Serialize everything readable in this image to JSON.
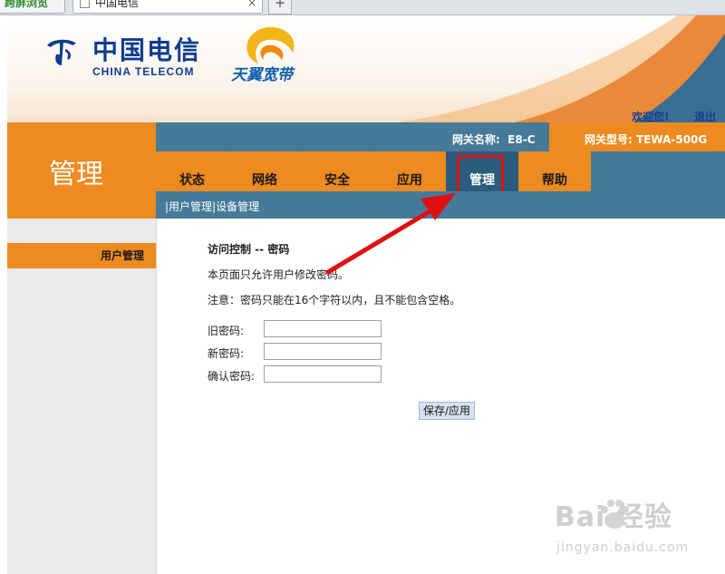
{
  "browser": {
    "tab1_label": "跨屏浏览",
    "tab2_label": "中国电信",
    "tab_close": "×",
    "new_tab": "+"
  },
  "header": {
    "logo_cn": "中国电信",
    "logo_en": "CHINA TELECOM",
    "tianyi": "天翼宽带",
    "welcome": "欢迎您!",
    "logout": "退出"
  },
  "section_title": "管理",
  "gateway": {
    "name_label": "网关名称:",
    "name_value": "E8-C",
    "type_label": "网关型号:",
    "type_value": "TEWA-500G"
  },
  "nav": {
    "tabs": [
      "状态",
      "网络",
      "安全",
      "应用",
      "管理",
      "帮助"
    ],
    "active": "管理"
  },
  "subnav": {
    "items": [
      "用户管理",
      "设备管理"
    ]
  },
  "sidebar": {
    "items": [
      "用户管理"
    ]
  },
  "content": {
    "title": "访问控制 -- 密码",
    "description": "本页面只允许用户修改密码。",
    "note": "注意：密码只能在16个字符以内，且不能包含空格。",
    "fields": [
      {
        "label": "旧密码:",
        "value": ""
      },
      {
        "label": "新密码:",
        "value": ""
      },
      {
        "label": "确认密码:",
        "value": ""
      }
    ],
    "save_button": "保存/应用"
  },
  "watermark": {
    "brand": "Bai  经验",
    "url": "jingyan.baidu.com"
  },
  "colors": {
    "orange": "#ed8a20",
    "steel_blue": "#457a99",
    "active_tab": "#2a5c7c",
    "highlight": "#e01010",
    "logo_blue": "#0e3d8f"
  }
}
